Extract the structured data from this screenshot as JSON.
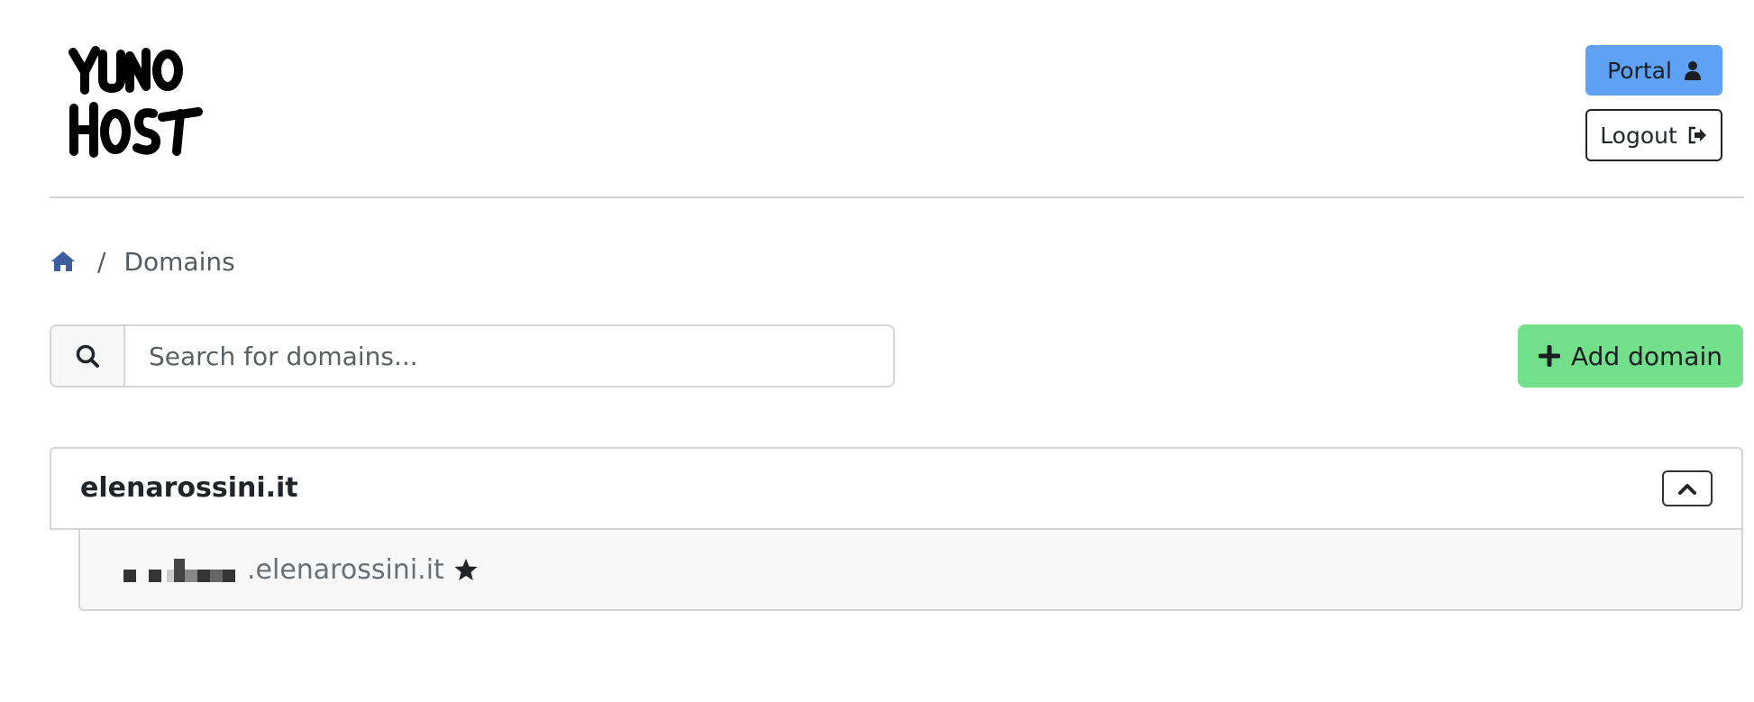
{
  "header": {
    "logo_text": "YUNO HOST",
    "portal_label": "Portal",
    "logout_label": "Logout"
  },
  "breadcrumb": {
    "current": "Domains"
  },
  "search": {
    "placeholder": "Search for domains..."
  },
  "actions": {
    "add_domain_label": "Add domain"
  },
  "domains": [
    {
      "name": "elenarossini.it",
      "subdomains": [
        {
          "suffix": ".elenarossini.it",
          "is_main": true
        }
      ]
    }
  ],
  "colors": {
    "portal_button": "#5fa2f5",
    "add_button": "#72e08a",
    "home_icon": "#3d5f9f"
  },
  "icons": {
    "portal": "user-icon",
    "logout": "sign-out-icon",
    "home": "home-icon",
    "search": "search-icon",
    "add": "plus-icon",
    "collapse": "chevron-up-icon",
    "main_domain": "star-icon"
  }
}
